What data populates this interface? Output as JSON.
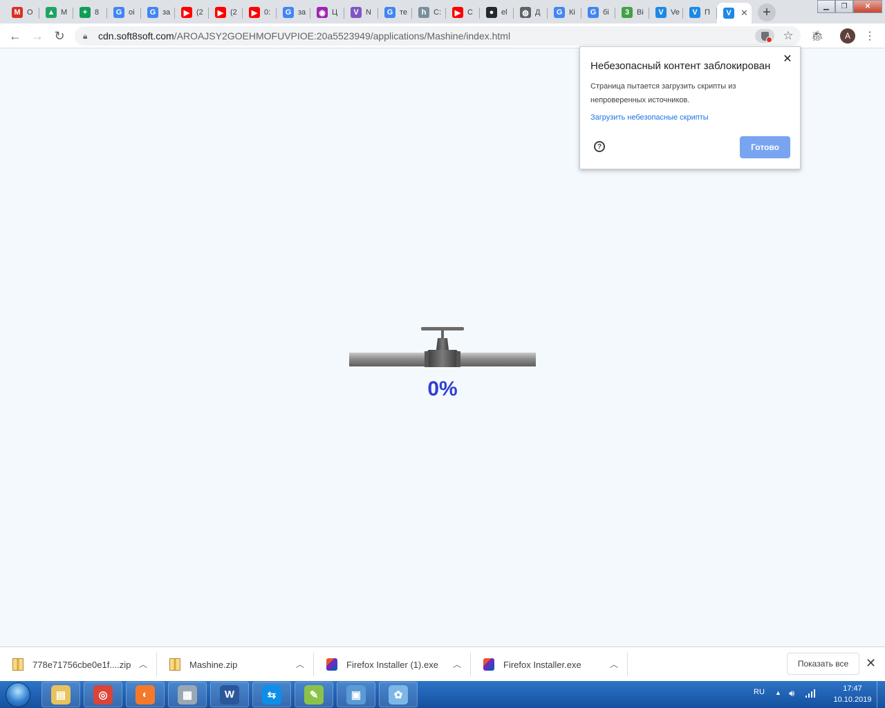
{
  "tabs": [
    {
      "title": "О",
      "icon": "gmail-icon",
      "color": "#d93025",
      "glyph": "M"
    },
    {
      "title": "М",
      "icon": "google-drive-icon",
      "color": "#1fa463",
      "glyph": "▲"
    },
    {
      "title": "8",
      "icon": "google-sheets-icon",
      "color": "#0f9d58",
      "glyph": "+"
    },
    {
      "title": "оі",
      "icon": "google-icon",
      "color": "#4285f4",
      "glyph": "G"
    },
    {
      "title": "за",
      "icon": "google-icon",
      "color": "#4285f4",
      "glyph": "G"
    },
    {
      "title": "(2",
      "icon": "youtube-icon",
      "color": "#ff0000",
      "glyph": "▶"
    },
    {
      "title": "(2",
      "icon": "youtube-icon",
      "color": "#ff0000",
      "glyph": "▶"
    },
    {
      "title": "0:",
      "icon": "youtube-icon",
      "color": "#ff0000",
      "glyph": "▶"
    },
    {
      "title": "за",
      "icon": "google-icon",
      "color": "#4285f4",
      "glyph": "G"
    },
    {
      "title": "Ц",
      "icon": "color-wheel-icon",
      "color": "#9c27b0",
      "glyph": "◉"
    },
    {
      "title": "N",
      "icon": "vuetify-icon",
      "color": "#7e57c2",
      "glyph": "V"
    },
    {
      "title": "те",
      "icon": "google-icon",
      "color": "#4285f4",
      "glyph": "G"
    },
    {
      "title": "С:",
      "icon": "habr-icon",
      "color": "#78909c",
      "glyph": "h"
    },
    {
      "title": "С",
      "icon": "youtube-icon",
      "color": "#ff0000",
      "glyph": "▶"
    },
    {
      "title": "el",
      "icon": "github-icon",
      "color": "#24292e",
      "glyph": "●"
    },
    {
      "title": "Д",
      "icon": "globe-icon",
      "color": "#5f6368",
      "glyph": "◍"
    },
    {
      "title": "Кі",
      "icon": "google-icon",
      "color": "#4285f4",
      "glyph": "G"
    },
    {
      "title": "бі",
      "icon": "google-icon",
      "color": "#4285f4",
      "glyph": "G"
    },
    {
      "title": "Ві",
      "icon": "verge3d-icon",
      "color": "#43a047",
      "glyph": "3"
    },
    {
      "title": "Ve",
      "icon": "verge3d-icon",
      "color": "#1e88e5",
      "glyph": "V"
    },
    {
      "title": "П",
      "icon": "verge3d-icon",
      "color": "#1e88e5",
      "glyph": "V"
    },
    {
      "title": "",
      "icon": "verge3d-icon",
      "color": "#1e88e5",
      "glyph": "V",
      "active": true
    }
  ],
  "address": {
    "host": "cdn.soft8soft.com",
    "path": "/AROAJSY2GOEHMOFUVPIOE:20a5523949/applications/Mashine/index.html"
  },
  "account_initial": "A",
  "progress": {
    "text": "0%",
    "value": 0
  },
  "popup": {
    "title": "Небезопасный контент заблокирован",
    "body": "Страница пытается загрузить скрипты из непроверенных источников.",
    "link": "Загрузить небезопасные скрипты",
    "done": "Готово"
  },
  "downloads": [
    {
      "name": "778e71756cbe0e1f....zip",
      "type": "zip"
    },
    {
      "name": "Mashine.zip",
      "type": "zip"
    },
    {
      "name": "Firefox Installer (1).exe",
      "type": "exe"
    },
    {
      "name": "Firefox Installer.exe",
      "type": "exe"
    }
  ],
  "shelf": {
    "show_all": "Показать все"
  },
  "taskbar": {
    "apps": [
      {
        "name": "explorer-icon",
        "color": "#e8c25c",
        "glyph": "▤"
      },
      {
        "name": "chrome-icon",
        "color": "#db4437",
        "glyph": "◎"
      },
      {
        "name": "blender-icon",
        "color": "#f5792a",
        "glyph": "◐"
      },
      {
        "name": "calculator-icon",
        "color": "#9aa7b4",
        "glyph": "▦"
      },
      {
        "name": "word-icon",
        "color": "#2b579a",
        "glyph": "W"
      },
      {
        "name": "teamviewer-icon",
        "color": "#0e8ee9",
        "glyph": "⇆"
      },
      {
        "name": "notepadpp-icon",
        "color": "#8bc34a",
        "glyph": "✎"
      },
      {
        "name": "photo-viewer-icon",
        "color": "#5b9bd5",
        "glyph": "▣"
      },
      {
        "name": "paint-icon",
        "color": "#7cb7e8",
        "glyph": "✿"
      }
    ],
    "lang": "RU",
    "time": "17:47",
    "date": "10.10.2019"
  }
}
